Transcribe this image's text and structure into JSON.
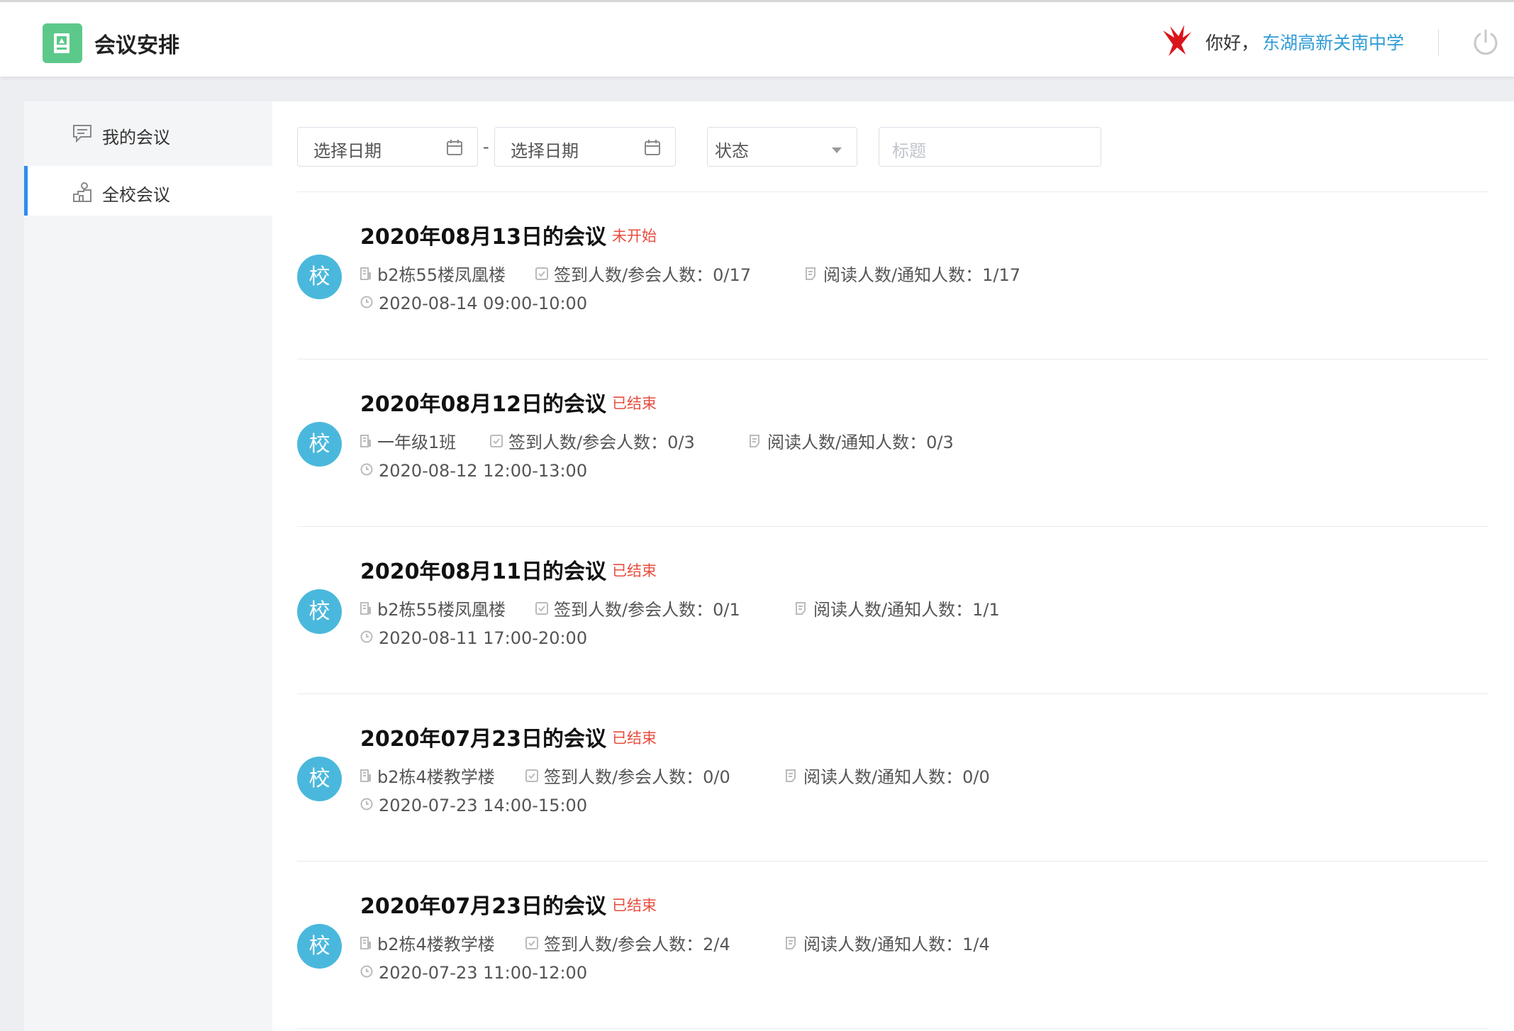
{
  "header": {
    "app_title": "会议安排",
    "greeting": "你好，",
    "school_name": "东湖高新关南中学"
  },
  "sidebar": {
    "items": [
      {
        "label": "我的会议",
        "icon": "chat-icon",
        "active": false
      },
      {
        "label": "全校会议",
        "icon": "school-icon",
        "active": true
      }
    ]
  },
  "filters": {
    "start_date_placeholder": "选择日期",
    "end_date_placeholder": "选择日期",
    "separator": "-",
    "status_placeholder": "状态",
    "title_placeholder": "标题"
  },
  "meetings": [
    {
      "avatar": "校",
      "title": "2020年08月13日的会议",
      "status": "未开始",
      "location": "b2栋55楼凤凰楼",
      "signin_label": "签到人数/参会人数：",
      "signin": "0/17",
      "read_label": "阅读人数/通知人数：",
      "read": "1/17",
      "time": "2020-08-14 09:00-10:00"
    },
    {
      "avatar": "校",
      "title": "2020年08月12日的会议",
      "status": "已结束",
      "location": "一年级1班",
      "signin_label": "签到人数/参会人数：",
      "signin": "0/3",
      "read_label": "阅读人数/通知人数：",
      "read": "0/3",
      "time": "2020-08-12 12:00-13:00"
    },
    {
      "avatar": "校",
      "title": "2020年08月11日的会议",
      "status": "已结束",
      "location": "b2栋55楼凤凰楼",
      "signin_label": "签到人数/参会人数：",
      "signin": "0/1",
      "read_label": "阅读人数/通知人数：",
      "read": "1/1",
      "time": "2020-08-11 17:00-20:00"
    },
    {
      "avatar": "校",
      "title": "2020年07月23日的会议",
      "status": "已结束",
      "location": "b2栋4楼教学楼",
      "signin_label": "签到人数/参会人数：",
      "signin": "0/0",
      "read_label": "阅读人数/通知人数：",
      "read": "0/0",
      "time": "2020-07-23 14:00-15:00"
    },
    {
      "avatar": "校",
      "title": "2020年07月23日的会议",
      "status": "已结束",
      "location": "b2栋4楼教学楼",
      "signin_label": "签到人数/参会人数：",
      "signin": "2/4",
      "read_label": "阅读人数/通知人数：",
      "read": "1/4",
      "time": "2020-07-23 11:00-12:00"
    }
  ],
  "colors": {
    "accent": "#2d8cf0",
    "logo_green": "#5cc98a",
    "avatar_blue": "#4ab8dc",
    "status_red": "#e84c3d",
    "link_blue": "#2f9bd6"
  }
}
